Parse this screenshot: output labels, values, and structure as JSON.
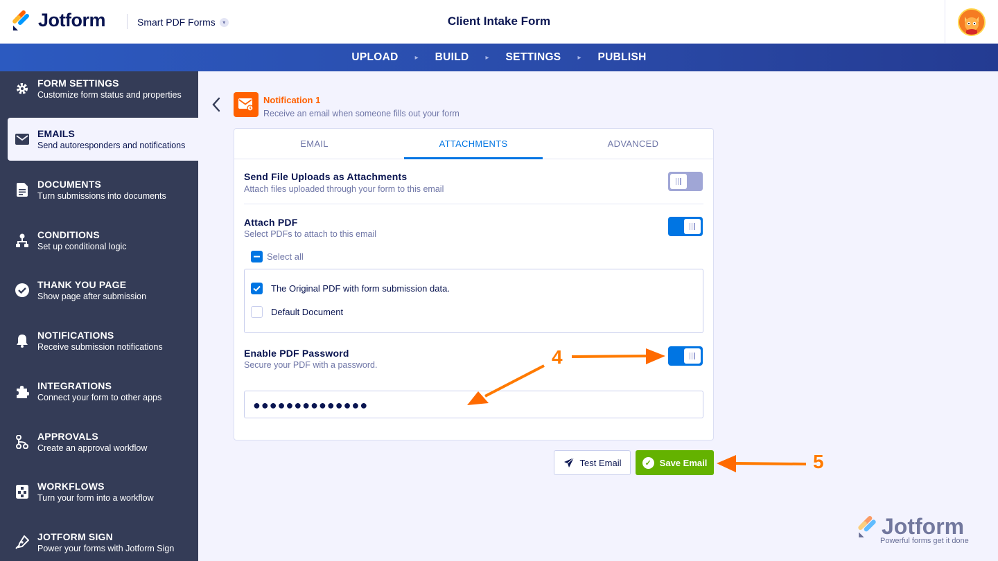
{
  "header": {
    "logo_text": "Jotform",
    "product": "Smart PDF Forms",
    "form_title": "Client Intake Form"
  },
  "nav": {
    "items": [
      "UPLOAD",
      "BUILD",
      "SETTINGS",
      "PUBLISH"
    ]
  },
  "sidebar": {
    "items": [
      {
        "title": "FORM SETTINGS",
        "sub": "Customize form status and properties",
        "icon": "gear-icon"
      },
      {
        "title": "EMAILS",
        "sub": "Send autoresponders and notifications",
        "icon": "envelope-icon"
      },
      {
        "title": "DOCUMENTS",
        "sub": "Turn submissions into documents",
        "icon": "document-icon"
      },
      {
        "title": "CONDITIONS",
        "sub": "Set up conditional logic",
        "icon": "conditions-icon"
      },
      {
        "title": "THANK YOU PAGE",
        "sub": "Show page after submission",
        "icon": "check-circle-icon"
      },
      {
        "title": "NOTIFICATIONS",
        "sub": "Receive submission notifications",
        "icon": "bell-icon"
      },
      {
        "title": "INTEGRATIONS",
        "sub": "Connect your form to other apps",
        "icon": "puzzle-icon"
      },
      {
        "title": "APPROVALS",
        "sub": "Create an approval workflow",
        "icon": "approval-icon"
      },
      {
        "title": "WORKFLOWS",
        "sub": "Turn your form into a workflow",
        "icon": "workflow-icon"
      },
      {
        "title": "JOTFORM SIGN",
        "sub": "Power your forms with Jotform Sign",
        "icon": "pen-icon"
      }
    ]
  },
  "notification": {
    "title": "Notification 1",
    "sub": "Receive an email when someone fills out your form"
  },
  "tabs": [
    "EMAIL",
    "ATTACHMENTS",
    "ADVANCED"
  ],
  "settings": {
    "uploads_title": "Send File Uploads as Attachments",
    "uploads_sub": "Attach files uploaded through your form to this email",
    "attach_title": "Attach PDF",
    "attach_sub": "Select PDFs to attach to this email",
    "select_all": "Select all",
    "pdf_options": [
      "The Original PDF with form submission data.",
      "Default Document"
    ],
    "password_title": "Enable PDF Password",
    "password_sub": "Secure your PDF with a password.",
    "password_value": "●●●●●●●●●●●●●●"
  },
  "buttons": {
    "test": "Test Email",
    "save": "Save Email"
  },
  "annotations": {
    "step4": "4",
    "step5": "5"
  },
  "watermark": {
    "text": "Jotform",
    "sub": "Powerful forms get it done"
  },
  "colors": {
    "accent_blue": "#0075e3",
    "orange": "#ff6100",
    "save_green": "#64b200",
    "sidebar": "#343c57"
  }
}
